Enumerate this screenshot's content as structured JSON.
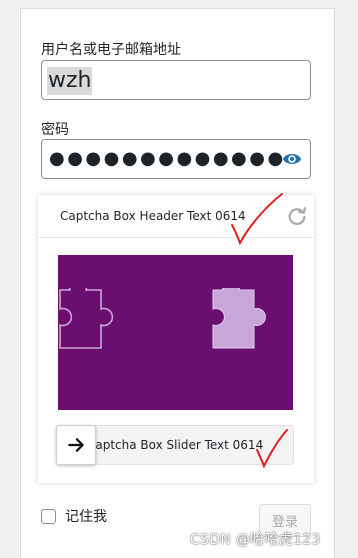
{
  "login": {
    "username_label": "用户名或电子邮箱地址",
    "username_value": "wzh",
    "password_label": "密码",
    "password_mask": "●●●●●●●●●●●●●",
    "remember_label": "记住我",
    "submit_label": "登录"
  },
  "captcha": {
    "header_text": "Captcha Box Header Text 0614",
    "slider_text": "Captcha Box Slider Text 0614",
    "puzzle_bg_color": "#6a0f70",
    "piece_fill_color": "#c9a6d9"
  },
  "icons": {
    "password_toggle": "eye-icon",
    "refresh": "refresh-icon",
    "slider_handle": "arrow-right-icon"
  },
  "annotation_color": "#e02020",
  "watermark": "CSDN @哈哈虎123"
}
